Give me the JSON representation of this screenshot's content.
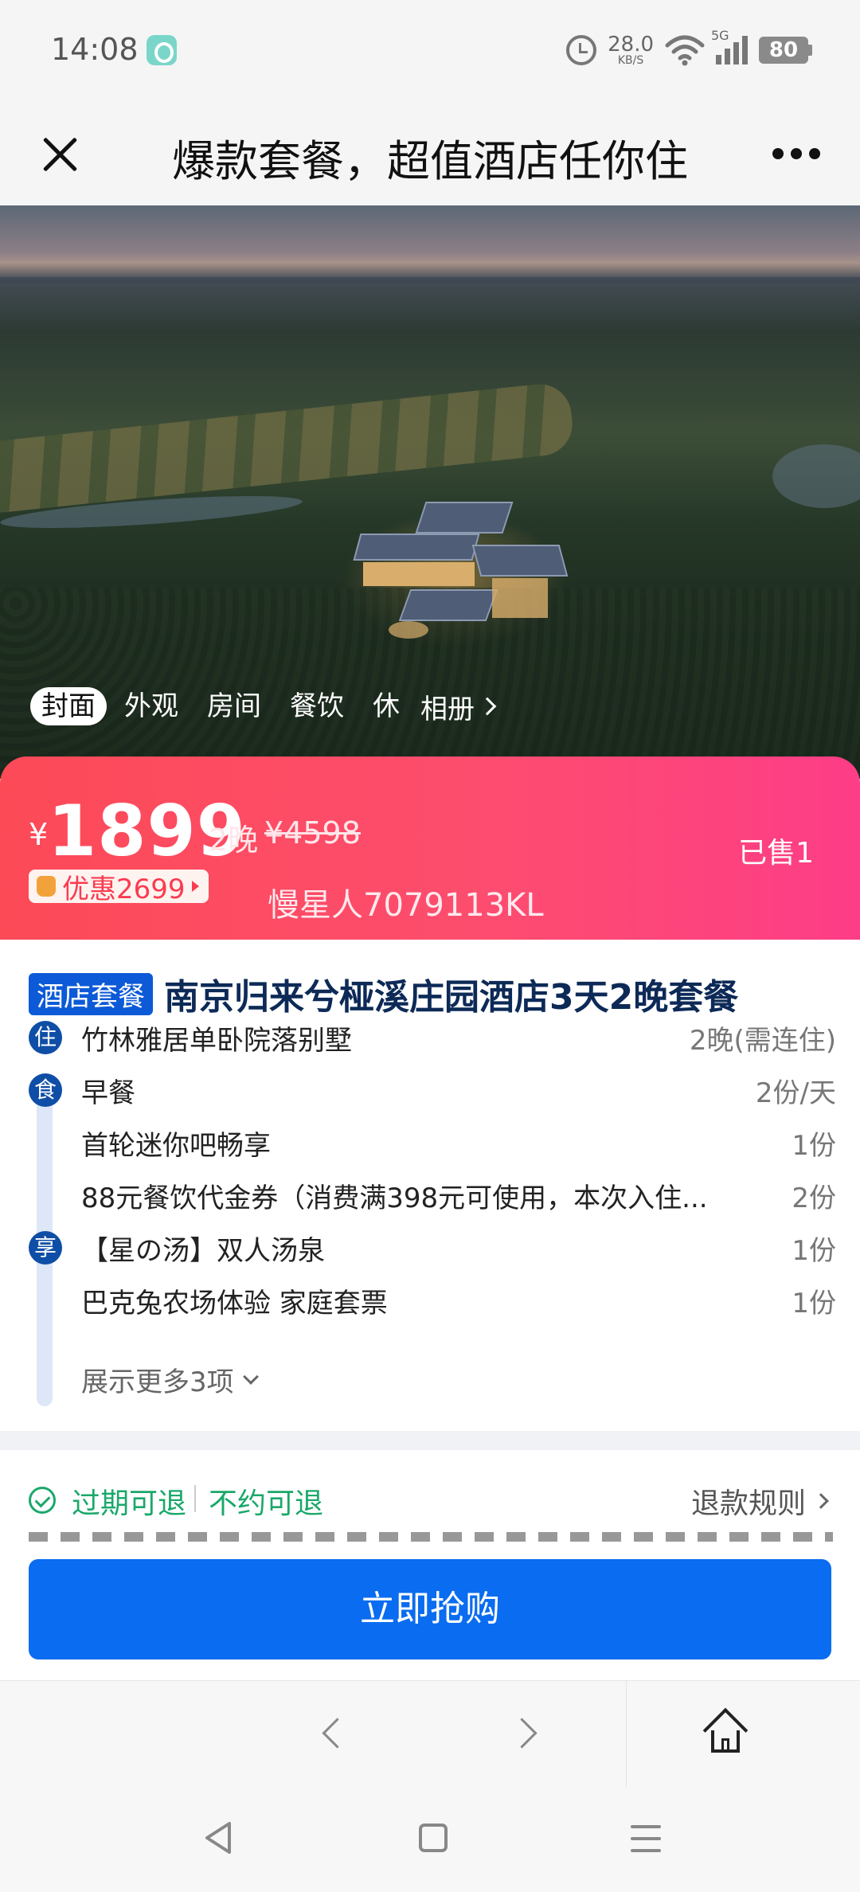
{
  "status_bar": {
    "time": "14:08",
    "net_speed": "28.0",
    "net_unit": "KB/S",
    "signal_label": "5G",
    "battery": "80"
  },
  "title_bar": {
    "title": "爆款套餐，超值酒店任你住",
    "close_icon": "close-icon",
    "more_icon": "more-icon"
  },
  "hero": {
    "tabs": [
      "封面",
      "外观",
      "房间",
      "餐饮",
      "休"
    ],
    "album_label": "相册"
  },
  "price_banner": {
    "currency": "¥",
    "price": "1899",
    "nights": "2晚",
    "original_price": "¥4598",
    "discount": "优惠2699",
    "username": "慢星人7079113KL",
    "sold": "已售1"
  },
  "package": {
    "tag": "酒店套餐",
    "name": "南京归来兮桠溪庄园酒店3天2晚套餐",
    "groups": [
      {
        "icon_label": "住",
        "items": [
          {
            "name": "竹林雅居单卧院落别墅",
            "qty": "2晚(需连住)"
          }
        ]
      },
      {
        "icon_label": "食",
        "items": [
          {
            "name": "早餐",
            "qty": "2份/天"
          },
          {
            "name": "首轮迷你吧畅享",
            "qty": "1份"
          },
          {
            "name": "88元餐饮代金券（消费满398元可使用，本次入住...",
            "qty": "2份"
          }
        ]
      },
      {
        "icon_label": "享",
        "items": [
          {
            "name": "【星の汤】双人汤泉",
            "qty": "1份"
          },
          {
            "name": "巴克兔农场体验 家庭套票",
            "qty": "1份"
          }
        ]
      }
    ],
    "show_more": "展示更多3项"
  },
  "refund": {
    "tag1": "过期可退",
    "tag2": "不约可退",
    "rules_label": "退款规则"
  },
  "buy_button": "立即抢购",
  "colors": {
    "brand_blue": "#0a6cf0",
    "banner_start": "#fd4a57",
    "banner_end": "#fd3d87",
    "refund_green": "#1aa86a",
    "title_navy": "#0d2a57"
  }
}
